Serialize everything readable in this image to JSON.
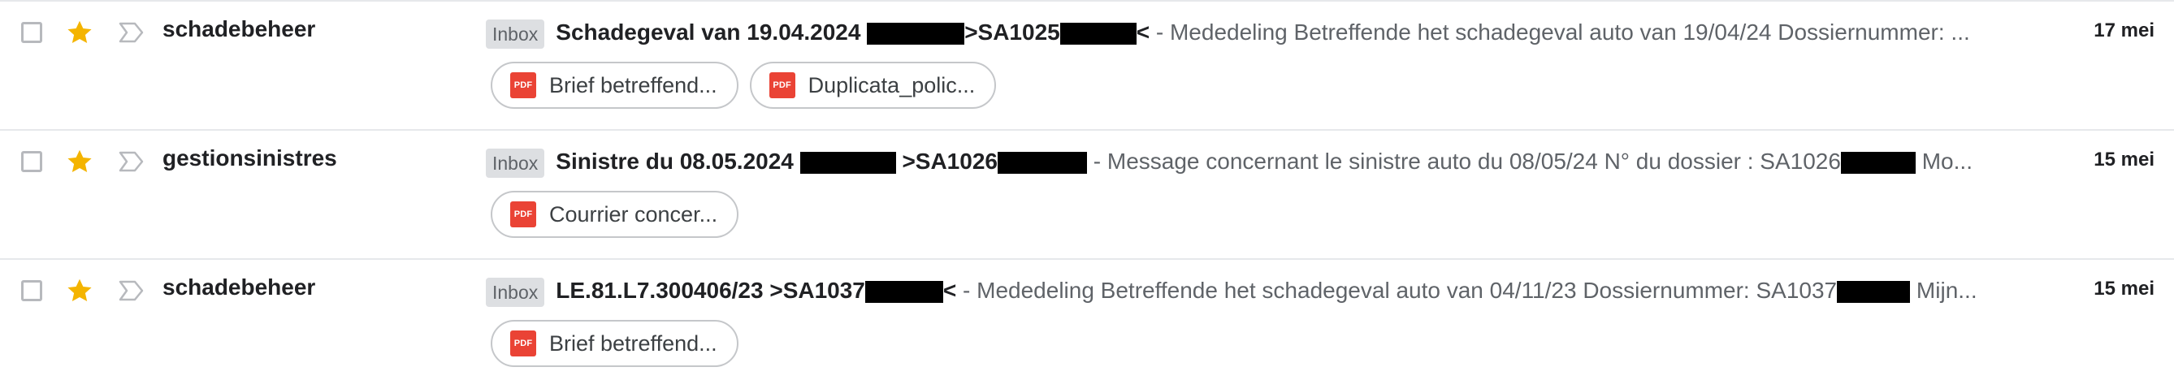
{
  "emails": [
    {
      "sender": "schadebeheer",
      "starred": true,
      "badge": "Inbox",
      "subject_part1": "Schadegeval van 19.04.2024 ",
      "subject_part2": ">SA1025",
      "subject_part3": "<",
      "snippet": "- Mededeling Betreffende het schadegeval auto van 19/04/24 Dossiernummer: ...",
      "date": "17 mei",
      "attachments": [
        {
          "icon": "pdf-icon",
          "label": "Brief betreffend..."
        },
        {
          "icon": "pdf-icon",
          "label": "Duplicata_polic..."
        }
      ]
    },
    {
      "sender": "gestionsinistres",
      "starred": true,
      "badge": "Inbox",
      "subject_part1": "Sinistre du 08.05.2024 ",
      "subject_part2": ">SA1026",
      "subject_part3": "",
      "snippet": "- Message concernant le sinistre auto du 08/05/24 N° du dossier : SA1026",
      "snippet_tail": "Mo...",
      "date": "15 mei",
      "attachments": [
        {
          "icon": "pdf-icon",
          "label": "Courrier concer..."
        }
      ]
    },
    {
      "sender": "schadebeheer",
      "starred": true,
      "badge": "Inbox",
      "subject_part1": "LE.81.L7.300406/23 >SA1037",
      "subject_part3": "<",
      "snippet": "- Mededeling Betreffende het schadegeval auto van 04/11/23 Dossiernummer: SA1037",
      "snippet_tail": "Mijn...",
      "date": "15 mei",
      "attachments": [
        {
          "icon": "pdf-icon",
          "label": "Brief betreffend..."
        }
      ]
    }
  ],
  "pdf_icon_text": "PDF",
  "colors": {
    "star": "#f4b400",
    "pdf": "#ea4335",
    "badge_bg": "#dddfe2",
    "divider": "#e6e8eb"
  }
}
